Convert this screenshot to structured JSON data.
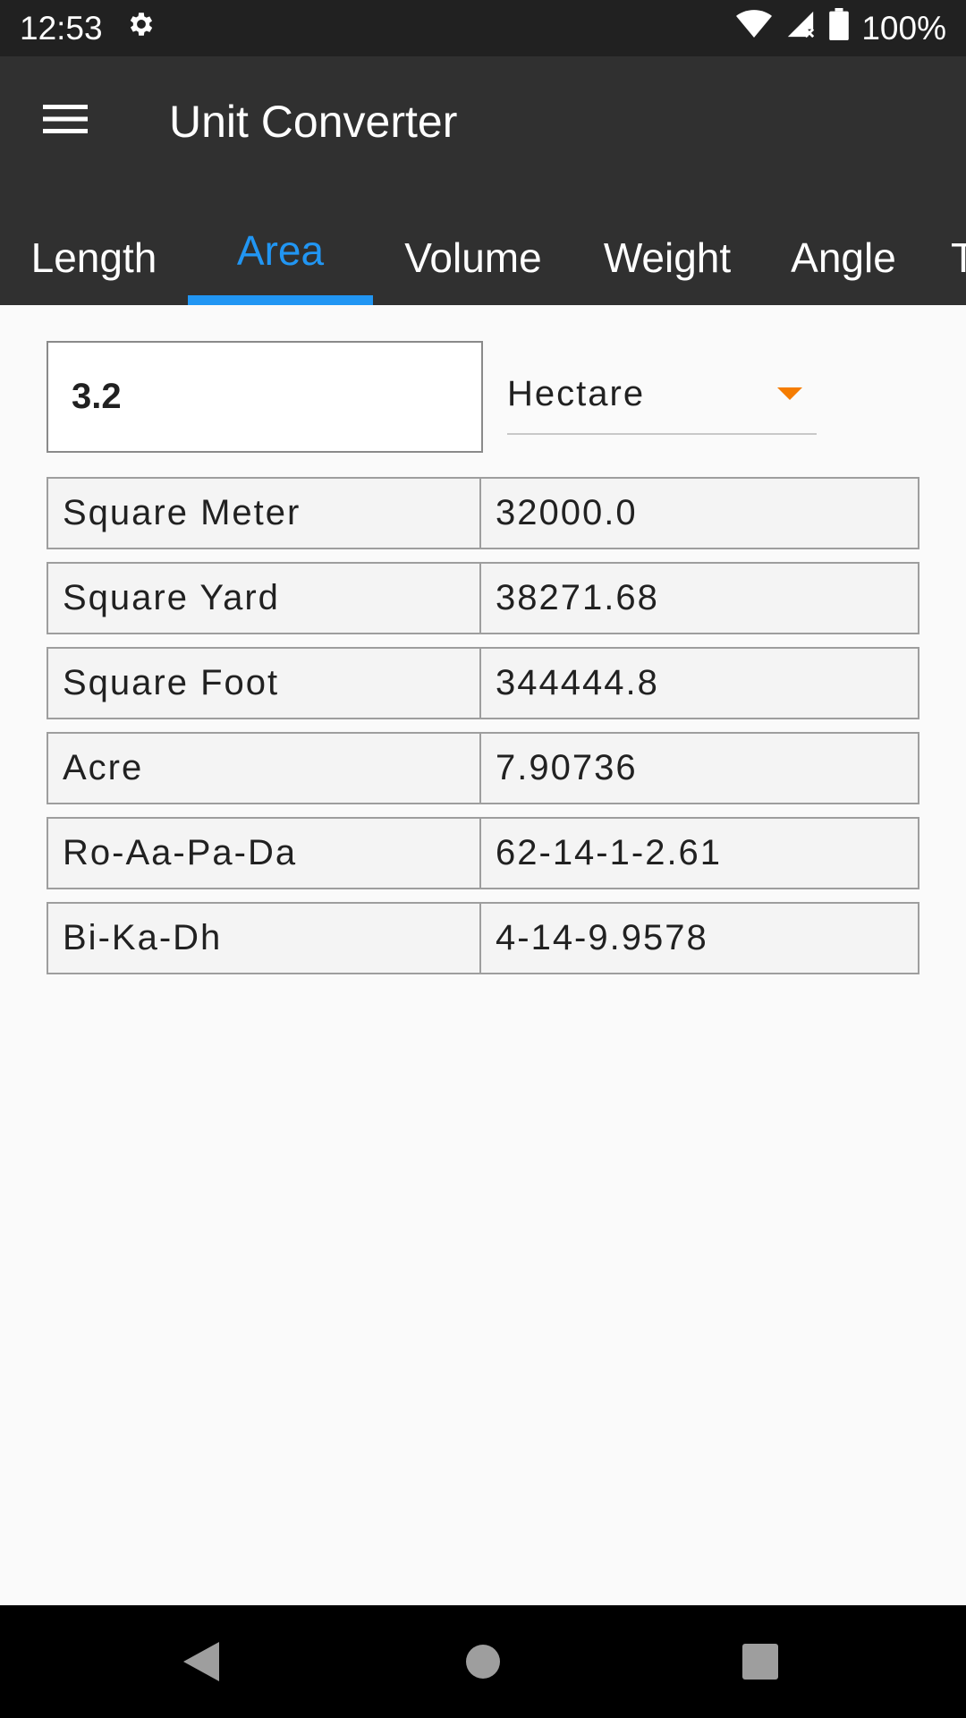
{
  "status_bar": {
    "time": "12:53",
    "battery_percent": "100%",
    "icons": [
      "settings-icon",
      "wifi-icon",
      "cell-signal-icon",
      "battery-icon"
    ]
  },
  "app_bar": {
    "title": "Unit Converter",
    "menu_icon": "hamburger-menu-icon"
  },
  "tabs": [
    {
      "label": "Length",
      "active": false
    },
    {
      "label": "Area",
      "active": true
    },
    {
      "label": "Volume",
      "active": false
    },
    {
      "label": "Weight",
      "active": false
    },
    {
      "label": "Angle",
      "active": false
    },
    {
      "label": "T",
      "active": false
    }
  ],
  "converter": {
    "input_value": "3.2",
    "selected_unit": "Hectare"
  },
  "results": [
    {
      "unit": "Square Meter",
      "value": "32000.0"
    },
    {
      "unit": "Square Yard",
      "value": "38271.68"
    },
    {
      "unit": "Square Foot",
      "value": "344444.8"
    },
    {
      "unit": "Acre",
      "value": "7.90736"
    },
    {
      "unit": "Ro-Aa-Pa-Da",
      "value": "62-14-1-2.61"
    },
    {
      "unit": "Bi-Ka-Dh",
      "value": "4-14-9.9578"
    }
  ],
  "nav_bar": {
    "buttons": [
      "back-icon",
      "home-icon",
      "recents-icon"
    ]
  },
  "colors": {
    "accent": "#2196f3",
    "app_bar": "#303030",
    "status_bar": "#212121",
    "dropdown_arrow": "#f57c00"
  }
}
